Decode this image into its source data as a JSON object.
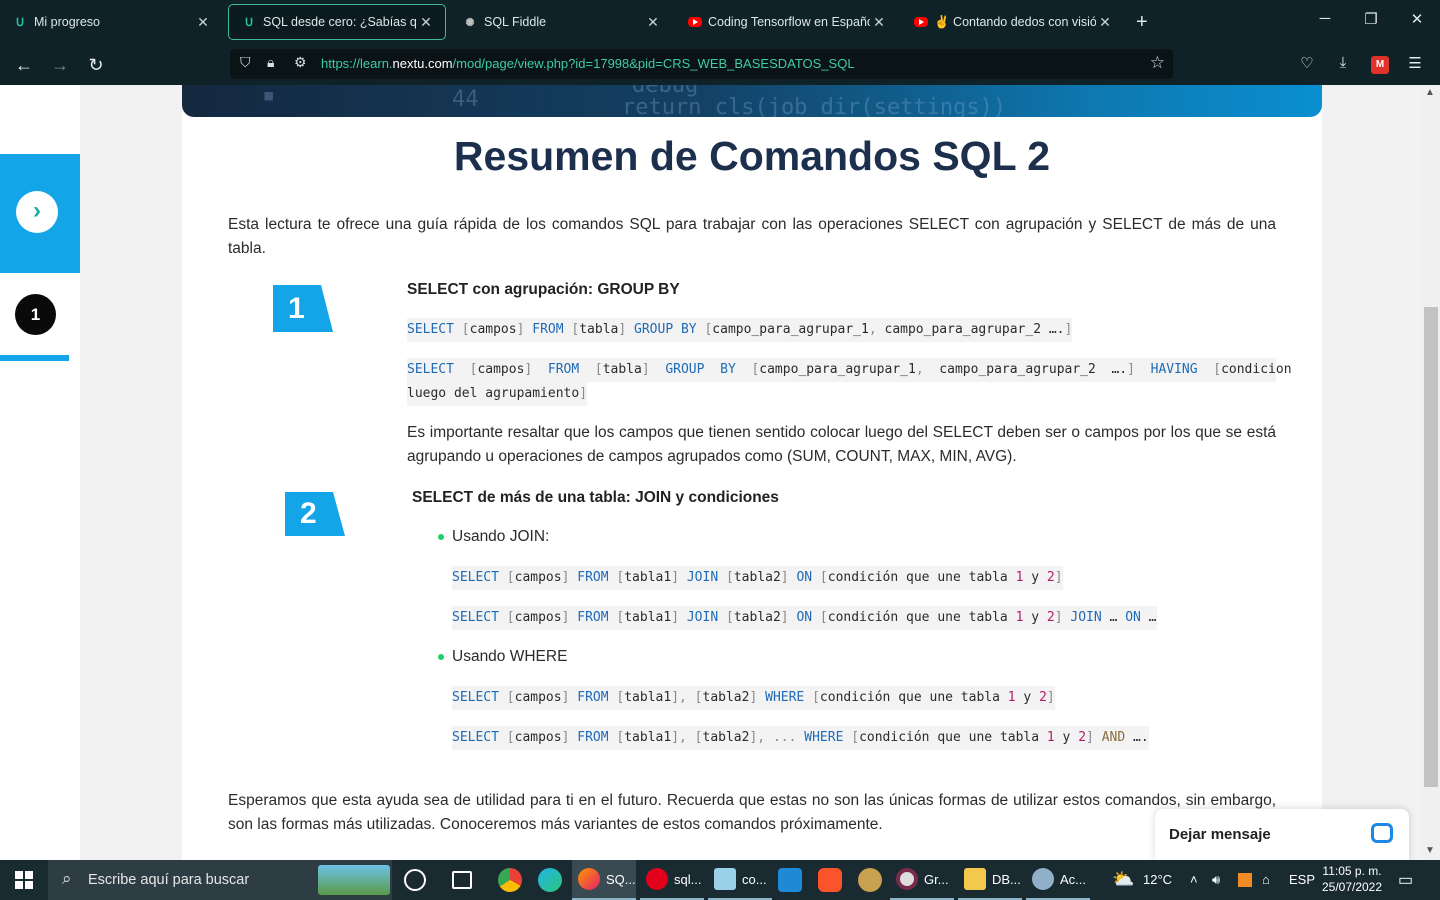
{
  "browser": {
    "tabs": [
      {
        "title": "Mi progreso",
        "favicon": "nextu-icon"
      },
      {
        "title": "SQL desde cero: ¿Sabías que?",
        "favicon": "nextu-icon",
        "active": true
      },
      {
        "title": "SQL Fiddle",
        "favicon": "sqlfiddle-icon"
      },
      {
        "title": "Coding Tensorflow en Español",
        "favicon": "youtube-icon"
      },
      {
        "title": "✌ Contando dedos con visión",
        "favicon": "youtube-icon"
      }
    ],
    "url_prefix": "https://learn.",
    "url_domain": "nextu.com",
    "url_rest": "/mod/page/view.php?id=17998&pid=CRS_WEB_BASESDATOS_SQL"
  },
  "sidebar": {
    "step_number": "1"
  },
  "article": {
    "title": "Resumen de Comandos SQL 2",
    "intro": "Esta lectura te ofrece una guía rápida de los comandos SQL para trabajar con las operaciones SELECT con agrupación y SELECT de más de una tabla.",
    "section1": {
      "badge": "1",
      "heading": "SELECT con agrupación: GROUP BY",
      "note": "Es importante resaltar que los campos que tienen sentido colocar luego del SELECT deben ser o campos por los que se está agrupando u operaciones de campos agrupados como (SUM, COUNT, MAX, MIN, AVG)."
    },
    "section2": {
      "badge": "2",
      "heading": "SELECT de más de una tabla: JOIN y condiciones",
      "bullet_join": "Usando JOIN:",
      "bullet_where": "Usando WHERE"
    },
    "outro": "Esperamos que esta ayuda sea de utilidad para ti en el futuro. Recuerda que estas no son las únicas formas de utilizar estos comandos, sin embargo, son las formas más utilizadas. Conoceremos más variantes de estos comandos próximamente."
  },
  "chat": {
    "label": "Dejar mensaje"
  },
  "taskbar": {
    "search_placeholder": "Escribe aquí para buscar",
    "apps": [
      {
        "label": "SQ..."
      },
      {
        "label": "sql..."
      },
      {
        "label": "co..."
      },
      {
        "label": "Gr..."
      },
      {
        "label": "DB..."
      },
      {
        "label": "Ac..."
      }
    ],
    "weather": "12°C",
    "language": "ESP",
    "time": "11:05 p. m.",
    "date": "25/07/2022"
  },
  "colors": {
    "accent_blue": "#14a4e8",
    "title_navy": "#1c2f4d",
    "browser_accent": "#3fb8a0"
  }
}
